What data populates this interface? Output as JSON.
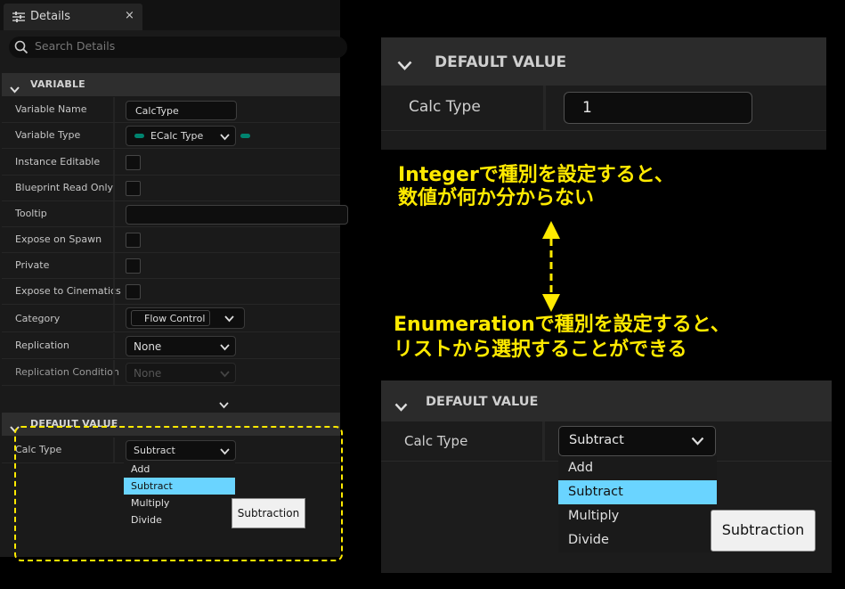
{
  "details_panel": {
    "tab_label": "Details",
    "tab_close": "×",
    "search_placeholder": "Search Details",
    "variable_category": "VARIABLE",
    "rows": {
      "variable_name": {
        "label": "Variable Name",
        "value": "CalcType"
      },
      "variable_type": {
        "label": "Variable Type",
        "value": "ECalc Type"
      },
      "instance_editable": {
        "label": "Instance Editable"
      },
      "blueprint_read_only": {
        "label": "Blueprint Read Only"
      },
      "tooltip": {
        "label": "Tooltip",
        "value": ""
      },
      "expose_on_spawn": {
        "label": "Expose on Spawn"
      },
      "private": {
        "label": "Private"
      },
      "expose_to_cinematics": {
        "label": "Expose to Cinematics"
      },
      "category": {
        "label": "Category",
        "value": "Flow Control"
      },
      "replication": {
        "label": "Replication",
        "value": "None"
      },
      "replication_condition": {
        "label": "Replication Condition",
        "value": "None"
      }
    },
    "default_value_category": "DEFAULT VALUE",
    "calc_type": {
      "label": "Calc Type",
      "value": "Subtract"
    },
    "dropdown_options": [
      "Add",
      "Subtract",
      "Multiply",
      "Divide"
    ],
    "selected_option": "Subtract",
    "button_label": "Subtraction"
  },
  "integer_panel": {
    "category": "DEFAULT VALUE",
    "label": "Calc Type",
    "value": "1"
  },
  "annotation": {
    "integer_line1": "Integerで種別を設定すると、",
    "integer_line2": "数値が何か分からない",
    "enum_line1": "Enumerationで種別を設定すると、",
    "enum_line2": "リストから選択することができる"
  },
  "enum_panel": {
    "category": "DEFAULT VALUE",
    "label": "Calc Type",
    "value": "Subtract",
    "dropdown_options": [
      "Add",
      "Subtract",
      "Multiply",
      "Divide"
    ],
    "selected_option": "Subtract",
    "button_label": "Subtraction"
  },
  "colors": {
    "highlight": "#6ad4ff",
    "annotation_yellow": "#ffea00",
    "enum_pin": "#00846f"
  }
}
